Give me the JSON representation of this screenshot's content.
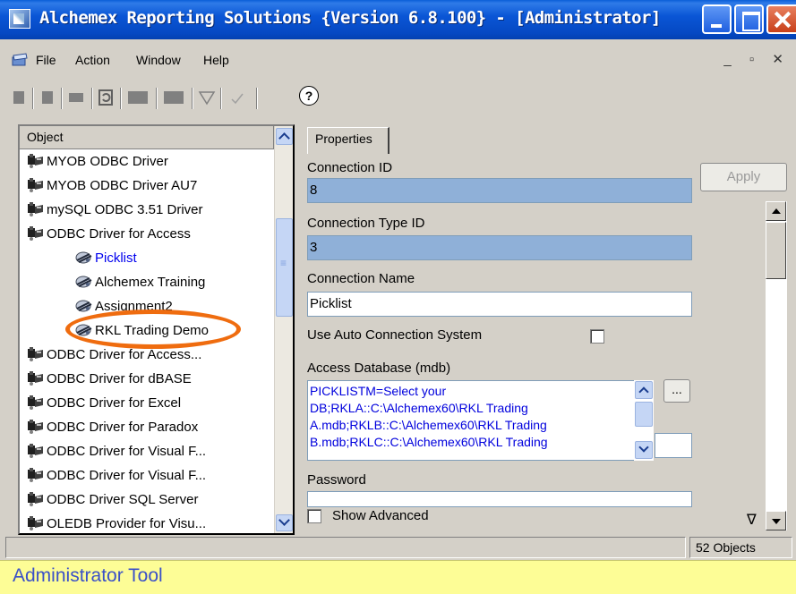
{
  "window": {
    "title": "Alchemex Reporting Solutions {Version 6.8.100} - [Administrator]"
  },
  "menu": {
    "items": [
      "File",
      "Action",
      "Window",
      "Help"
    ]
  },
  "tree": {
    "header": "Object",
    "items": [
      {
        "label": "MYOB ODBC Driver",
        "kind": "driver"
      },
      {
        "label": "MYOB ODBC Driver AU7",
        "kind": "driver"
      },
      {
        "label": "mySQL ODBC 3.51 Driver",
        "kind": "driver"
      },
      {
        "label": "ODBC Driver for Access",
        "kind": "driver"
      },
      {
        "label": "Picklist",
        "kind": "connection",
        "selected": true
      },
      {
        "label": "Alchemex Training",
        "kind": "connection"
      },
      {
        "label": "Assignment2",
        "kind": "connection"
      },
      {
        "label": "RKL Trading Demo",
        "kind": "connection"
      },
      {
        "label": "ODBC Driver for Access...",
        "kind": "driver"
      },
      {
        "label": "ODBC Driver for dBASE",
        "kind": "driver"
      },
      {
        "label": "ODBC Driver for Excel",
        "kind": "driver"
      },
      {
        "label": "ODBC Driver for Paradox",
        "kind": "driver"
      },
      {
        "label": "ODBC Driver for Visual F...",
        "kind": "driver"
      },
      {
        "label": "ODBC Driver for Visual F...",
        "kind": "driver"
      },
      {
        "label": "ODBC Driver SQL Server",
        "kind": "driver"
      },
      {
        "label": "OLEDB Provider for Visu...",
        "kind": "driver"
      }
    ]
  },
  "properties": {
    "tab": "Properties",
    "apply_label": "Apply",
    "connection_id_label": "Connection ID",
    "connection_id_value": "8",
    "connection_type_label": "Connection Type ID",
    "connection_type_value": "3",
    "connection_name_label": "Connection Name",
    "connection_name_value": "Picklist",
    "auto_connection_label": "Use Auto Connection System",
    "access_db_label": "Access Database (mdb)",
    "access_db_lines": [
      "PICKLISTM=Select your",
      "DB;RKLA::C:\\Alchemex60\\RKL Trading",
      "A.mdb;RKLB::C:\\Alchemex60\\RKL Trading",
      "B.mdb;RKLC::C:\\Alchemex60\\RKL Trading"
    ],
    "ellipsis_label": "...",
    "password_label": "Password",
    "show_advanced_label": "Show Advanced",
    "nabla": "∇"
  },
  "status": {
    "objects": "52 Objects"
  },
  "caption": "Administrator Tool",
  "colors": {
    "highlight": "#ef6c0f",
    "readonly_field": "#8fb0d8",
    "selected_text": "#0000ee",
    "caption_bg": "#fdfd96",
    "caption_text": "#3a50c8"
  }
}
